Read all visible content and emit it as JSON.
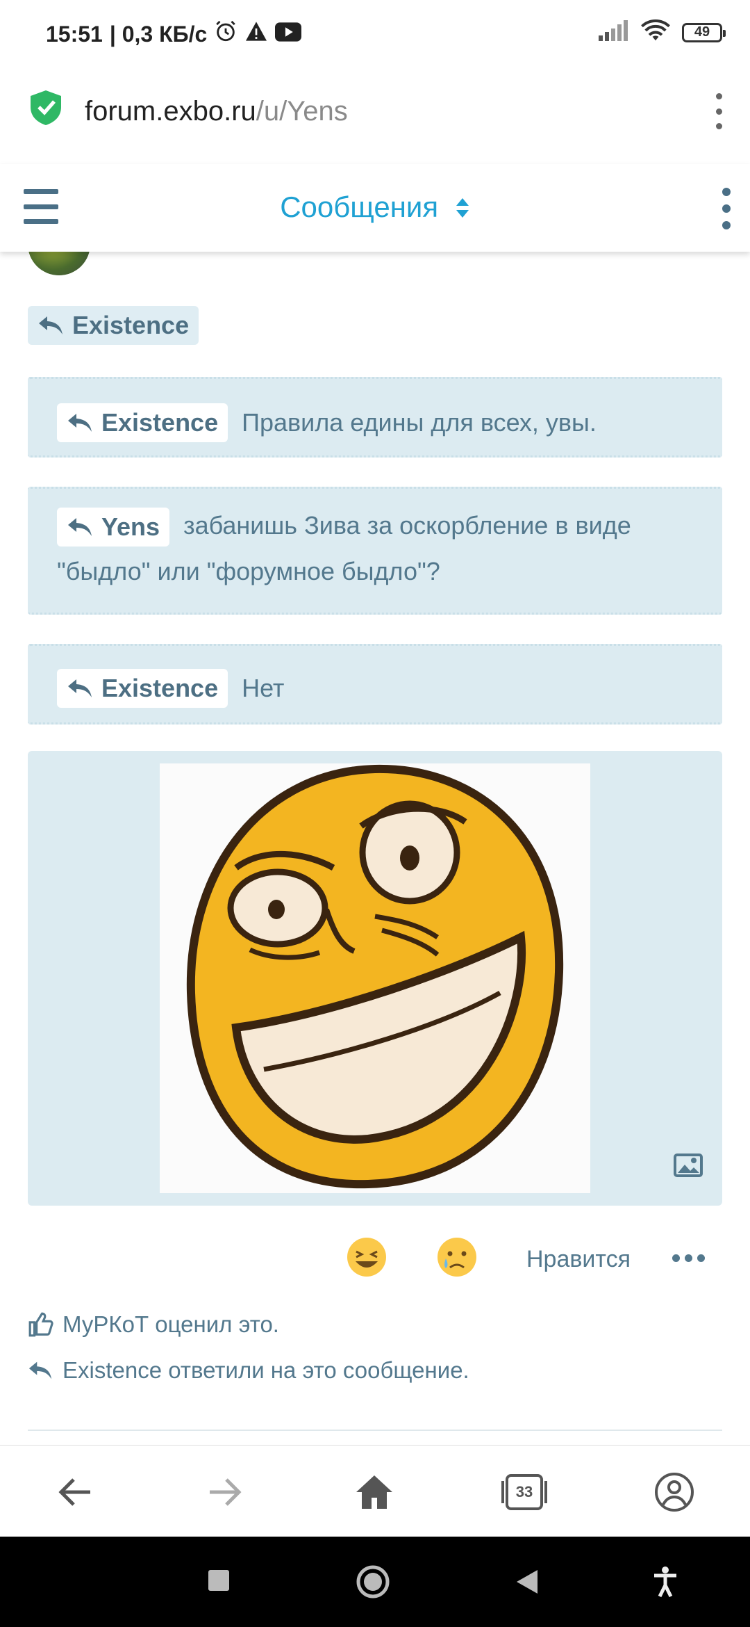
{
  "status_bar": {
    "time": "15:51",
    "speed": "| 0,3 КБ/с",
    "battery": "49"
  },
  "browser": {
    "url_domain": "forum.exbo.ru",
    "url_path": "/u/Yens",
    "tabs_count": "33"
  },
  "forum_header": {
    "title": "Сообщения"
  },
  "post": {
    "top_reply": "Existence",
    "quotes": [
      {
        "author": "Existence",
        "text": "Правила едины для всех, увы."
      },
      {
        "author": "Yens",
        "text": "забанишь Зива за оскорбление в виде \"быдло\" или \"форумное быдло\"?"
      },
      {
        "author": "Existence",
        "text": "Нет"
      }
    ],
    "like_label": "Нравится",
    "liked_by": "МуРКоТ оценил это.",
    "replied_by": "Existence ответили на это сообщение."
  },
  "colors": {
    "accent": "#1fa1d3",
    "quote_bg": "#dcebf1",
    "text": "#53788d"
  }
}
